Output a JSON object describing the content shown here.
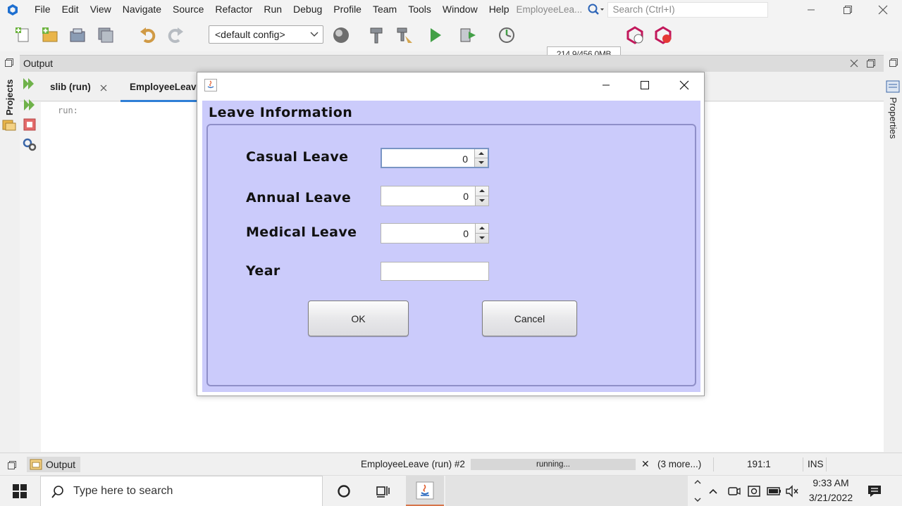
{
  "menubar": {
    "items": [
      "File",
      "Edit",
      "View",
      "Navigate",
      "Source",
      "Refactor",
      "Run",
      "Debug",
      "Profile",
      "Team",
      "Tools",
      "Window",
      "Help"
    ],
    "project_title": "EmployeeLea...",
    "search_placeholder": "Search (Ctrl+I)"
  },
  "toolbar": {
    "config": "<default config>",
    "memory": "214.9/456.0MB",
    "memory_used_fraction": 0.47
  },
  "side": {
    "projects_tab": "Projects",
    "properties_tab": "Properties"
  },
  "output": {
    "title": "Output",
    "tabs": [
      "slib (run)",
      "EmployeeLeave"
    ],
    "console_text": "run:"
  },
  "dialog": {
    "heading": "Leave Information",
    "fields": [
      {
        "label": "Casual Leave",
        "value": "0"
      },
      {
        "label": "Annual Leave",
        "value": "0"
      },
      {
        "label": "Medical Leave",
        "value": "0"
      }
    ],
    "year_label": "Year",
    "year_value": "",
    "ok_label": "OK",
    "cancel_label": "Cancel",
    "background": "#cbcbfb"
  },
  "status": {
    "output_tab": "Output",
    "task": "EmployeeLeave (run) #2",
    "progress_text": "running...",
    "more": "(3 more...)",
    "position": "191:1",
    "mode": "INS"
  },
  "taskbar": {
    "search_placeholder": "Type here to search",
    "time": "9:33 AM",
    "date": "3/21/2022"
  }
}
